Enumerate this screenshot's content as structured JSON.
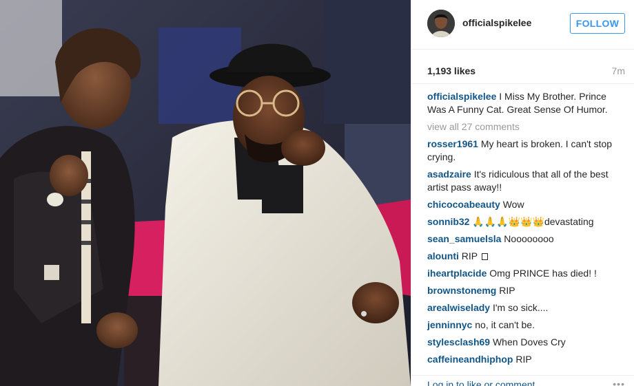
{
  "post": {
    "photo_alt": "",
    "photo_icon": "photo"
  },
  "header": {
    "username": "officialspikelee",
    "follow_label": "FOLLOW",
    "avatar_icon": "avatar"
  },
  "stats": {
    "likes": "1,193 likes",
    "time": "7m"
  },
  "caption": {
    "user": "officialspikelee",
    "text": " I Miss My Brother. Prince Was A Funny Cat. Great Sense Of Humor."
  },
  "view_all": "view all 27 comments",
  "comments": [
    {
      "user": "rosser1961",
      "text": " My heart is broken. I can't stop crying."
    },
    {
      "user": "asadzaire",
      "text": " It's ridiculous that all of the best artist pass away!!"
    },
    {
      "user": "chicocoabeauty",
      "text": " Wow"
    },
    {
      "user": "sonnib32",
      "text": " 🙏🙏🙏👑👑👑devastating"
    },
    {
      "user": "sean_samuelsla",
      "text": " Noooooooo"
    },
    {
      "user": "alounti",
      "text": " RIP "
    },
    {
      "user": "iheartplacide",
      "text": " Omg PRINCE has died! !"
    },
    {
      "user": "brownstonemg",
      "text": " RIP"
    },
    {
      "user": "arealwiselady",
      "text": " I'm so sick...."
    },
    {
      "user": "jenninnyc",
      "text": " no, it can't be."
    },
    {
      "user": "stylesclash69",
      "text": " When Doves Cry"
    },
    {
      "user": "caffeineandhiphop",
      "text": " RIP"
    }
  ],
  "footer": {
    "login_text": "Log in to like or comment.",
    "more_icon": "more-dots"
  },
  "colors": {
    "link": "#125688",
    "follow": "#3897f0",
    "muted": "#999999",
    "couch": "#d6205f"
  }
}
